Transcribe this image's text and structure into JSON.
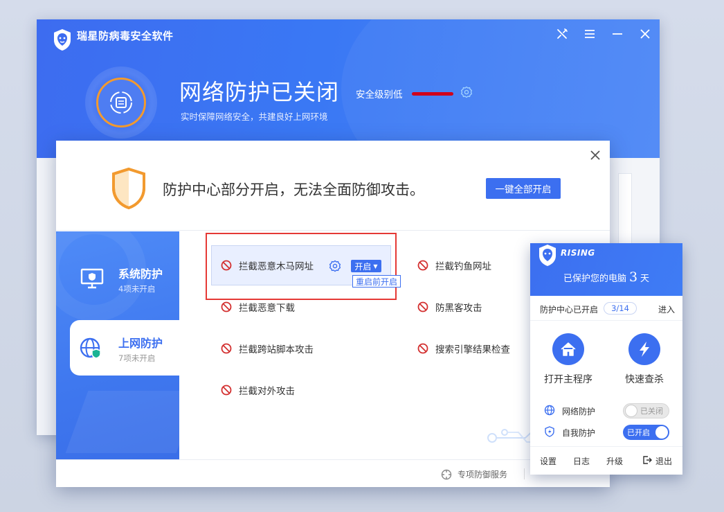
{
  "main": {
    "app_title": "瑞星防病毒安全软件",
    "status_title": "网络防护已关闭",
    "status_subtitle": "实时保障网络安全，共建良好上网环境",
    "security_level_label": "安全级别低",
    "colors": {
      "header": "#3d6cf0",
      "level_bar": "#d0021b",
      "shield_ring": "#f29a2f"
    },
    "window_icons": [
      "tools-icon",
      "menu-icon",
      "minimize-icon",
      "close-icon"
    ]
  },
  "dialog": {
    "warning_text": "防护中心部分开启，无法全面防御攻击。",
    "enable_all_label": "一键全部开启",
    "nav": [
      {
        "title": "系统防护",
        "subtitle": "4项未开启"
      },
      {
        "title": "上网防护",
        "subtitle": "7项未开启"
      }
    ],
    "items": {
      "trojan_url": "拦截恶意木马网址",
      "phishing_url": "拦截钓鱼网址",
      "malicious_download": "拦截恶意下载",
      "anti_hacker": "防黑客攻击",
      "xss": "拦截跨站脚本攻击",
      "search_check": "搜索引擎结果检查",
      "outbound_attack": "拦截对外攻击"
    },
    "trojan_open_label": "开启",
    "trojan_tooltip": "重启前开启",
    "footer_service": "专项防御服务",
    "colors": {
      "accent": "#3c6ff0",
      "ban": "#d32f2f",
      "highlight_frame": "#e53935"
    }
  },
  "mini": {
    "brand": "RISING",
    "protected_prefix": "已保护您的电脑",
    "protected_days": "3",
    "protected_suffix": "天",
    "center_label": "防护中心已开启",
    "center_count": "3/14",
    "enter_label": "进入",
    "open_main_label": "打开主程序",
    "quick_scan_label": "快速查杀",
    "net_protect_label": "网络防护",
    "net_protect_state": "已关闭",
    "self_protect_label": "自我防护",
    "self_protect_state": "已开启",
    "footer": {
      "settings": "设置",
      "log": "日志",
      "upgrade": "升级",
      "exit": "退出"
    }
  }
}
